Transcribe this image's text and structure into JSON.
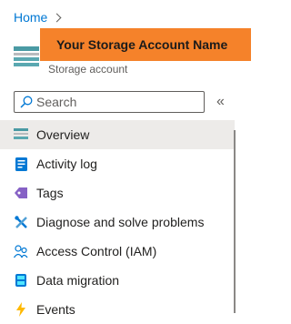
{
  "breadcrumb": {
    "home": "Home"
  },
  "resource": {
    "name": "Your Storage Account Name",
    "type": "Storage account",
    "icon": "storage-account-icon"
  },
  "search": {
    "placeholder": "Search",
    "value": ""
  },
  "collapse": {
    "label": "«"
  },
  "menu": {
    "items": [
      {
        "label": "Overview",
        "icon": "overview-icon",
        "selected": true
      },
      {
        "label": "Activity log",
        "icon": "activity-log-icon"
      },
      {
        "label": "Tags",
        "icon": "tag-icon"
      },
      {
        "label": "Diagnose and solve problems",
        "icon": "wrench-icon"
      },
      {
        "label": "Access Control (IAM)",
        "icon": "people-icon"
      },
      {
        "label": "Data migration",
        "icon": "data-migration-icon"
      },
      {
        "label": "Events",
        "icon": "lightning-icon"
      }
    ]
  },
  "colors": {
    "accent": "#0078d4",
    "banner": "#f5822a",
    "selected_bg": "#edebe9"
  }
}
